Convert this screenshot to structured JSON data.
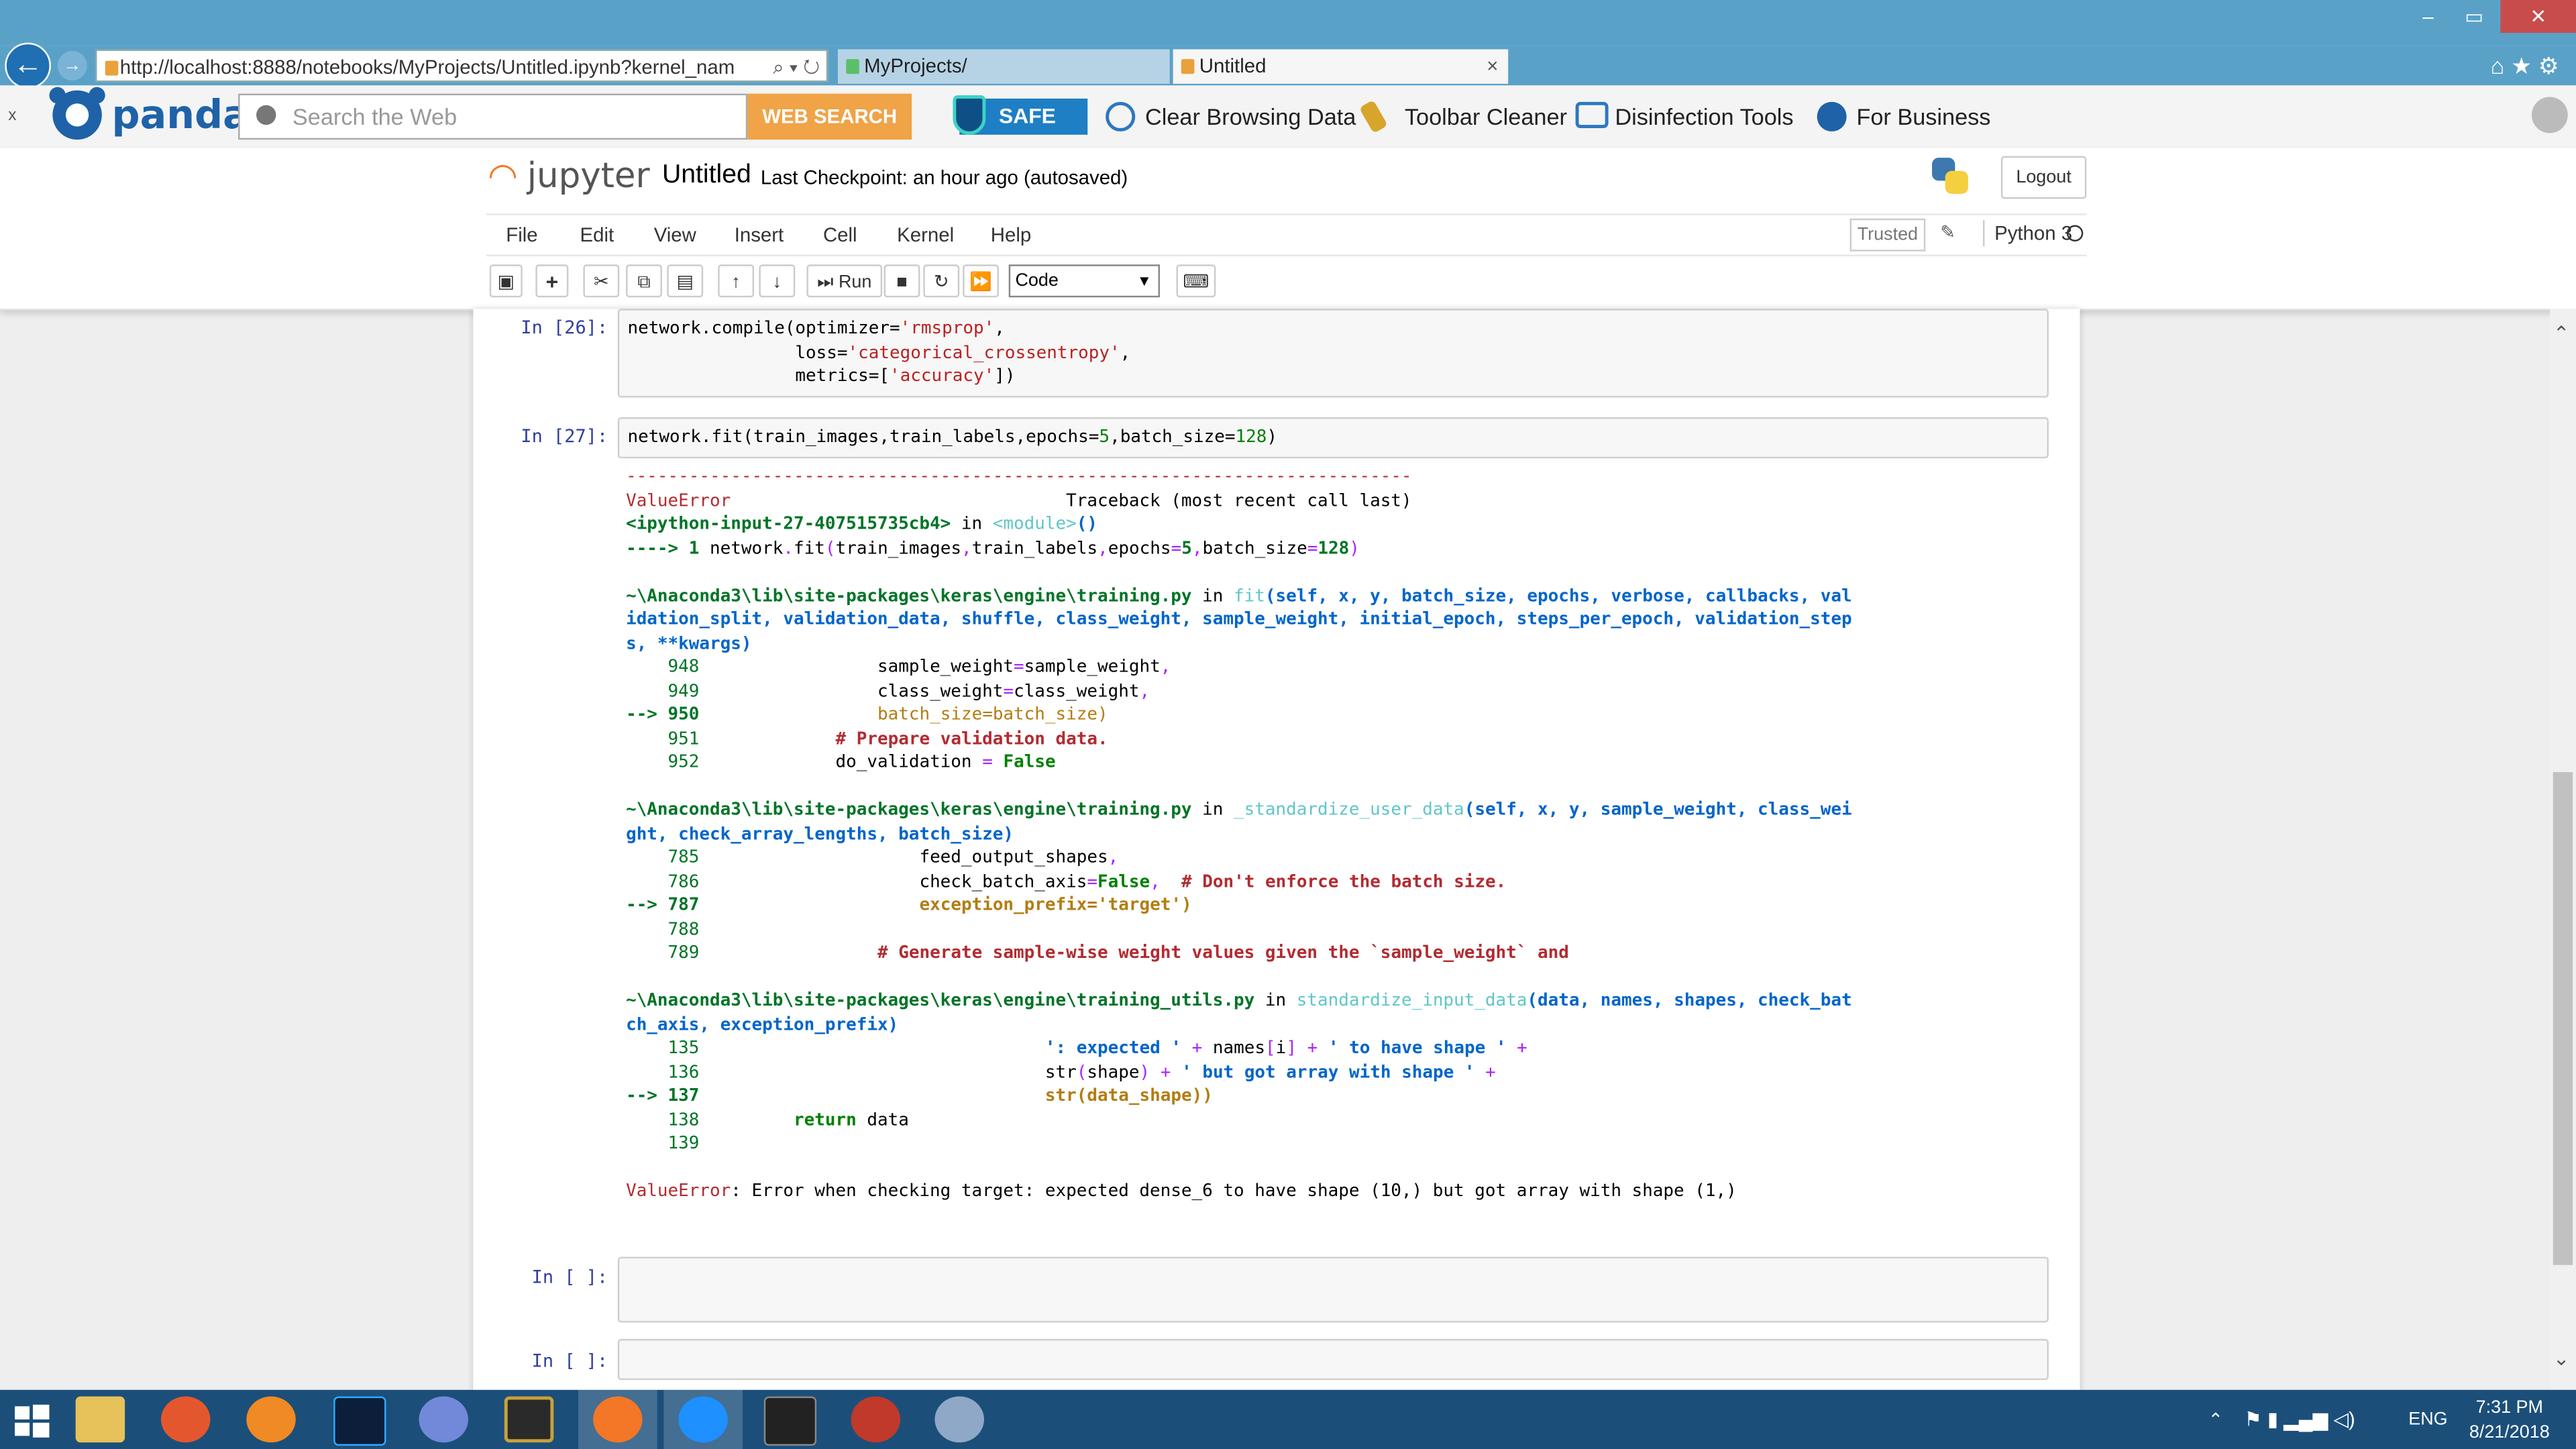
{
  "browser": {
    "address": "http://localhost:8888/notebooks/MyProjects/Untitled.ipynb?kernel_nam",
    "address_controls": "⌕ ▾ ↻",
    "tabs": [
      {
        "label": "MyProjects/"
      },
      {
        "label": "Untitled"
      }
    ],
    "tab_close": "×",
    "window_buttons": [
      "–",
      "▭",
      "✕"
    ],
    "right_nav": "⌂★⚙"
  },
  "panda_toolbar": {
    "brand": "panda",
    "search_placeholder": "Search the Web",
    "web_search_label": "WEB SEARCH",
    "safe_label": "SAFE",
    "items": [
      {
        "label": "Clear Browsing Data",
        "color": "#2c78c0"
      },
      {
        "label": "Toolbar Cleaner",
        "color": "#d8a52c"
      },
      {
        "label": "Disinfection Tools",
        "color": "#2c78c0"
      },
      {
        "label": "For Business",
        "color": "#1f62a8"
      }
    ],
    "close_label": "x"
  },
  "jupyter": {
    "logo_text": "jupyter",
    "notebook_name": "Untitled",
    "checkpoint": "Last Checkpoint: an hour ago  (autosaved)",
    "logout_label": "Logout",
    "menu": [
      "File",
      "Edit",
      "View",
      "Insert",
      "Cell",
      "Kernel",
      "Help"
    ],
    "trusted_label": "Trusted",
    "kernel_name": "Python 3",
    "run_label": "Run",
    "cell_type": "Code",
    "accent_color": "#f37726"
  },
  "cells": {
    "cell26_prompt": "In [26]:",
    "cell27_prompt": "In [27]:",
    "empty1_prompt": "In [ ]:",
    "empty2_prompt": "In [ ]:"
  },
  "taskbar": {
    "time": "7:31 PM",
    "date": "8/21/2018",
    "language": "ENG"
  }
}
